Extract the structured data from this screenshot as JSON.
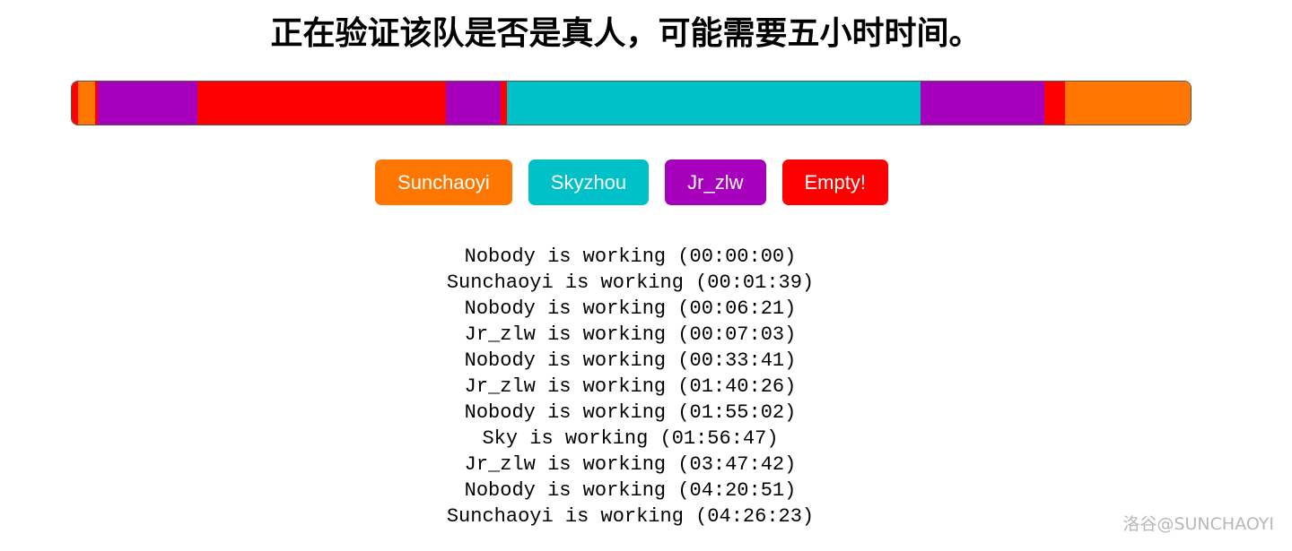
{
  "title": "正在验证该队是否是真人，可能需要五小时时间。",
  "colors": {
    "sunchaoyi": "#ff7700",
    "skyzhou": "#00c0c8",
    "jr_zlw": "#a600bc",
    "empty": "#ff0000"
  },
  "timeline": {
    "total_duration": "05:00:00",
    "segments": [
      {
        "owner": "Nobody",
        "color": "#ff0000",
        "start": "00:00:00",
        "end": "00:01:39"
      },
      {
        "owner": "Sunchaoyi",
        "color": "#ff7700",
        "start": "00:01:39",
        "end": "00:06:21"
      },
      {
        "owner": "Nobody",
        "color": "#ff0000",
        "start": "00:06:21",
        "end": "00:07:03"
      },
      {
        "owner": "Jr_zlw",
        "color": "#a600bc",
        "start": "00:07:03",
        "end": "00:33:41"
      },
      {
        "owner": "Nobody",
        "color": "#ff0000",
        "start": "00:33:41",
        "end": "01:40:26"
      },
      {
        "owner": "Jr_zlw",
        "color": "#a600bc",
        "start": "01:40:26",
        "end": "01:55:02"
      },
      {
        "owner": "Nobody",
        "color": "#ff0000",
        "start": "01:55:02",
        "end": "01:56:47"
      },
      {
        "owner": "Sky",
        "color": "#00c0c8",
        "start": "01:56:47",
        "end": "03:47:42"
      },
      {
        "owner": "Jr_zlw",
        "color": "#a600bc",
        "start": "03:47:42",
        "end": "04:20:51"
      },
      {
        "owner": "Nobody",
        "color": "#ff0000",
        "start": "04:20:51",
        "end": "04:26:23"
      },
      {
        "owner": "Sunchaoyi",
        "color": "#ff7700",
        "start": "04:26:23",
        "end": "05:00:00"
      }
    ]
  },
  "legend": [
    {
      "label": "Sunchaoyi",
      "color": "#ff7700"
    },
    {
      "label": "Skyzhou",
      "color": "#00c0c8"
    },
    {
      "label": "Jr_zlw",
      "color": "#a600bc"
    },
    {
      "label": "Empty!",
      "color": "#ff0000"
    }
  ],
  "log": [
    "Nobody is working (00:00:00)",
    "Sunchaoyi is working (00:01:39)",
    "Nobody is working (00:06:21)",
    "Jr_zlw is working (00:07:03)",
    "Nobody is working (00:33:41)",
    "Jr_zlw is working (01:40:26)",
    "Nobody is working (01:55:02)",
    "Sky is working (01:56:47)",
    "Jr_zlw is working (03:47:42)",
    "Nobody is working (04:20:51)",
    "Sunchaoyi is working (04:26:23)"
  ],
  "watermark": "洛谷@SUNCHAOYI"
}
